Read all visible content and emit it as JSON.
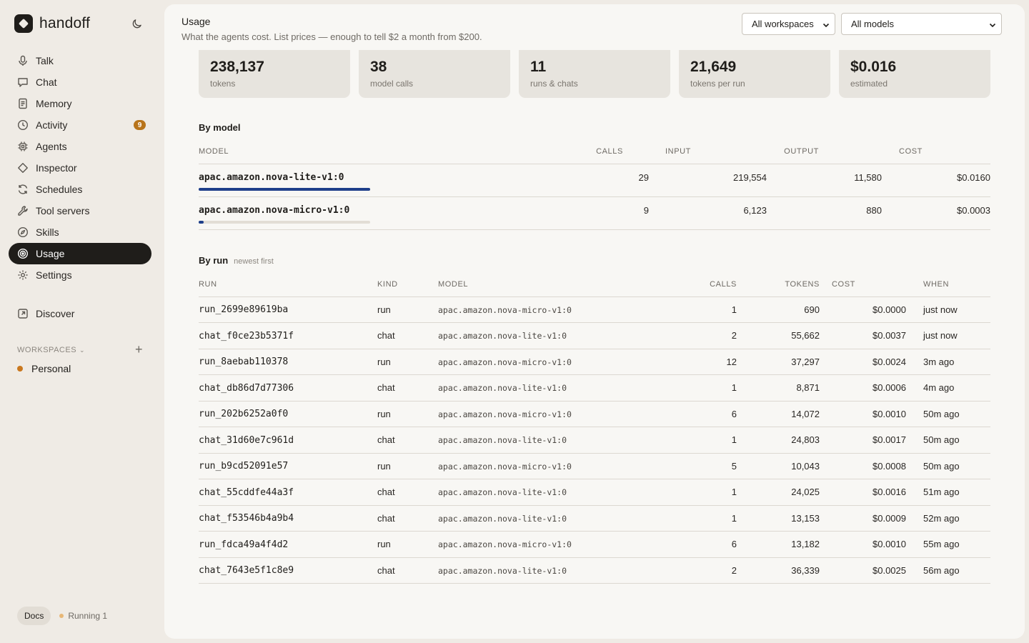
{
  "app": {
    "name": "handoff"
  },
  "nav": {
    "items": [
      {
        "label": "Talk",
        "icon": "mic-icon"
      },
      {
        "label": "Chat",
        "icon": "chat-icon"
      },
      {
        "label": "Memory",
        "icon": "document-icon"
      },
      {
        "label": "Activity",
        "icon": "clock-icon",
        "badge": "9"
      },
      {
        "label": "Agents",
        "icon": "chip-icon"
      },
      {
        "label": "Inspector",
        "icon": "diamond-icon"
      },
      {
        "label": "Schedules",
        "icon": "refresh-icon"
      },
      {
        "label": "Tool servers",
        "icon": "wrench-icon"
      },
      {
        "label": "Skills",
        "icon": "compass-icon"
      },
      {
        "label": "Usage",
        "icon": "target-icon",
        "active": true
      },
      {
        "label": "Settings",
        "icon": "gear-icon"
      }
    ],
    "discover": {
      "label": "Discover",
      "icon": "external-link-icon"
    }
  },
  "workspaces": {
    "title": "WORKSPACES",
    "items": [
      {
        "name": "Personal"
      }
    ]
  },
  "footer": {
    "docs_label": "Docs",
    "running_label": "Running 1"
  },
  "header": {
    "title": "Usage",
    "subtitle": "What the agents cost. List prices — enough to tell $2 a month from $200.",
    "workspace_select": "All workspaces",
    "model_select": "All models"
  },
  "stats": [
    {
      "value": "238,137",
      "label": "tokens"
    },
    {
      "value": "38",
      "label": "model calls"
    },
    {
      "value": "11",
      "label": "runs & chats"
    },
    {
      "value": "21,649",
      "label": "tokens per run"
    },
    {
      "value": "$0.016",
      "label": "estimated"
    }
  ],
  "by_model": {
    "title": "By model",
    "columns": [
      "MODEL",
      "CALLS",
      "INPUT",
      "OUTPUT",
      "COST"
    ],
    "rows": [
      {
        "model": "apac.amazon.nova-lite-v1:0",
        "calls": "29",
        "input": "219,554",
        "output": "11,580",
        "cost": "$0.0160",
        "share": 1.0
      },
      {
        "model": "apac.amazon.nova-micro-v1:0",
        "calls": "9",
        "input": "6,123",
        "output": "880",
        "cost": "$0.0003",
        "share": 0.03
      }
    ]
  },
  "by_run": {
    "title": "By run",
    "note": "newest first",
    "columns": [
      "RUN",
      "KIND",
      "MODEL",
      "CALLS",
      "TOKENS",
      "COST",
      "WHEN"
    ],
    "rows": [
      {
        "run": "run_2699e89619ba",
        "kind": "run",
        "model": "apac.amazon.nova-micro-v1:0",
        "calls": "1",
        "tokens": "690",
        "cost": "$0.0000",
        "when": "just now"
      },
      {
        "run": "chat_f0ce23b5371f",
        "kind": "chat",
        "model": "apac.amazon.nova-lite-v1:0",
        "calls": "2",
        "tokens": "55,662",
        "cost": "$0.0037",
        "when": "just now"
      },
      {
        "run": "run_8aebab110378",
        "kind": "run",
        "model": "apac.amazon.nova-micro-v1:0",
        "calls": "12",
        "tokens": "37,297",
        "cost": "$0.0024",
        "when": "3m ago"
      },
      {
        "run": "chat_db86d7d77306",
        "kind": "chat",
        "model": "apac.amazon.nova-lite-v1:0",
        "calls": "1",
        "tokens": "8,871",
        "cost": "$0.0006",
        "when": "4m ago"
      },
      {
        "run": "run_202b6252a0f0",
        "kind": "run",
        "model": "apac.amazon.nova-micro-v1:0",
        "calls": "6",
        "tokens": "14,072",
        "cost": "$0.0010",
        "when": "50m ago"
      },
      {
        "run": "chat_31d60e7c961d",
        "kind": "chat",
        "model": "apac.amazon.nova-lite-v1:0",
        "calls": "1",
        "tokens": "24,803",
        "cost": "$0.0017",
        "when": "50m ago"
      },
      {
        "run": "run_b9cd52091e57",
        "kind": "run",
        "model": "apac.amazon.nova-micro-v1:0",
        "calls": "5",
        "tokens": "10,043",
        "cost": "$0.0008",
        "when": "50m ago"
      },
      {
        "run": "chat_55cddfe44a3f",
        "kind": "chat",
        "model": "apac.amazon.nova-lite-v1:0",
        "calls": "1",
        "tokens": "24,025",
        "cost": "$0.0016",
        "when": "51m ago"
      },
      {
        "run": "chat_f53546b4a9b4",
        "kind": "chat",
        "model": "apac.amazon.nova-lite-v1:0",
        "calls": "1",
        "tokens": "13,153",
        "cost": "$0.0009",
        "when": "52m ago"
      },
      {
        "run": "run_fdca49a4f4d2",
        "kind": "run",
        "model": "apac.amazon.nova-micro-v1:0",
        "calls": "6",
        "tokens": "13,182",
        "cost": "$0.0010",
        "when": "55m ago"
      },
      {
        "run": "chat_7643e5f1c8e9",
        "kind": "chat",
        "model": "apac.amazon.nova-lite-v1:0",
        "calls": "2",
        "tokens": "36,339",
        "cost": "$0.0025",
        "when": "56m ago"
      }
    ]
  },
  "colors": {
    "accent": "#1e3f8a",
    "badge": "#b8741a",
    "workspace_dot": "#c9781f",
    "active_nav": "#1f1d1a"
  }
}
